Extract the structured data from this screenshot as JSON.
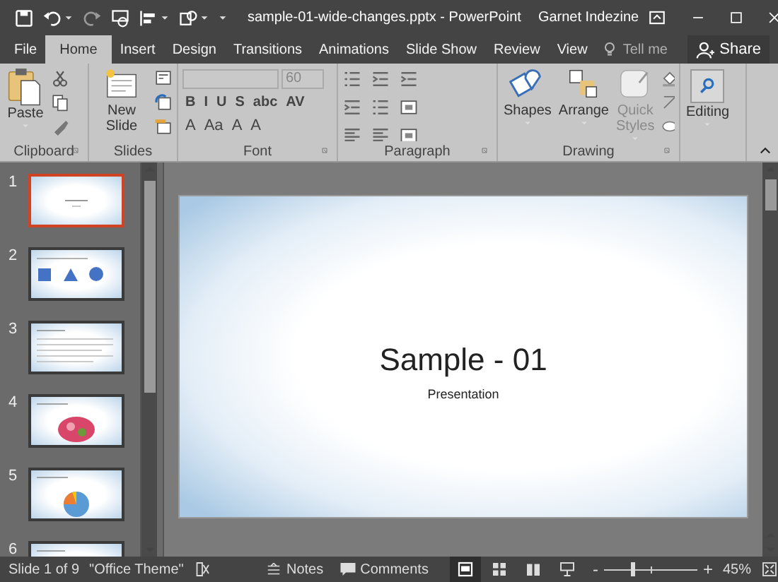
{
  "window": {
    "title": "sample-01-wide-changes.pptx - PowerPoint",
    "user": "Garnet Indezine"
  },
  "tabs": [
    {
      "label": "File",
      "selected": false
    },
    {
      "label": "Home",
      "selected": true
    },
    {
      "label": "Insert",
      "selected": false
    },
    {
      "label": "Design",
      "selected": false
    },
    {
      "label": "Transitions",
      "selected": false
    },
    {
      "label": "Animations",
      "selected": false
    },
    {
      "label": "Slide Show",
      "selected": false
    },
    {
      "label": "Review",
      "selected": false
    },
    {
      "label": "View",
      "selected": false
    }
  ],
  "tell_me": {
    "placeholder": "Tell me"
  },
  "share": "Share",
  "ribbon": {
    "clipboard": {
      "label": "Clipboard",
      "paste": "Paste"
    },
    "slides": {
      "label": "Slides",
      "new_slide": "New Slide"
    },
    "font": {
      "label": "Font",
      "font_size": "60",
      "format_buttons": [
        "B",
        "I",
        "U",
        "S",
        "abc",
        "AV"
      ],
      "size_buttons": [
        "A",
        "Aa",
        "A",
        "A"
      ]
    },
    "paragraph": {
      "label": "Paragraph"
    },
    "drawing": {
      "label": "Drawing",
      "commands": [
        {
          "label": "Shapes",
          "disabled": false
        },
        {
          "label": "Arrange",
          "disabled": false
        },
        {
          "label": "Quick Styles",
          "disabled": true
        }
      ]
    },
    "editing": {
      "label": "Editing"
    }
  },
  "slides": [
    {
      "number": "1",
      "selected": true,
      "kind": "title"
    },
    {
      "number": "2",
      "selected": false,
      "kind": "shapes"
    },
    {
      "number": "3",
      "selected": false,
      "kind": "text"
    },
    {
      "number": "4",
      "selected": false,
      "kind": "picture"
    },
    {
      "number": "5",
      "selected": false,
      "kind": "chart"
    },
    {
      "number": "6",
      "selected": false,
      "kind": "text"
    }
  ],
  "slide": {
    "title": "Sample - 01",
    "subtitle": "Presentation"
  },
  "status_bar": {
    "slide_position": "Slide 1 of 9",
    "theme": "\"Office Theme\"",
    "notes": "Notes",
    "comments": "Comments",
    "views": [
      {
        "kind": "normal",
        "selected": true
      },
      {
        "kind": "sorter",
        "selected": false
      },
      {
        "kind": "reading",
        "selected": false
      },
      {
        "kind": "slideshow",
        "selected": false
      }
    ],
    "zoom": {
      "level": 0.3,
      "reading": "45%",
      "zoom_out": "-",
      "zoom_in": "+"
    }
  }
}
